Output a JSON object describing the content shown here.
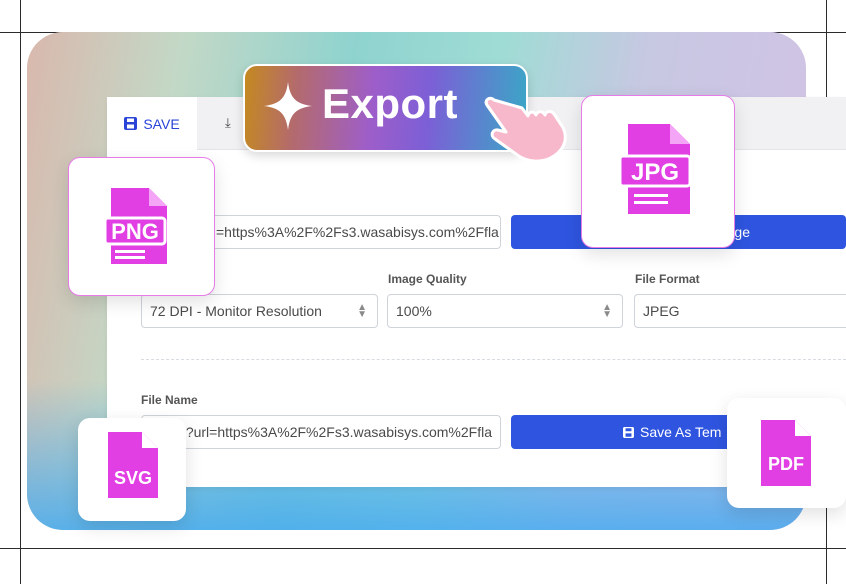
{
  "tabs": {
    "save_label": "SAVE",
    "download_label": ""
  },
  "export_label": "Export",
  "form": {
    "url_value_top": "=https%3A%2F%2Fs3.wasabisys.com%2Ffla",
    "top_button_label": "ge",
    "dpi_value": "72 DPI - Monitor Resolution",
    "quality_label": "Image Quality",
    "quality_value": "100%",
    "format_label": "File Format",
    "format_value": "JPEG",
    "file_name_label": "File Name",
    "file_name_value": "?url=https%3A%2F%2Fs3.wasabisys.com%2Ffla",
    "save_template_label": "Save As Tem"
  },
  "badges": {
    "png": "PNG",
    "jpg": "JPG",
    "svg": "SVG",
    "pdf": "PDF"
  },
  "colors": {
    "accent": "#2f55e0",
    "file_icon": "#e13ee3"
  }
}
